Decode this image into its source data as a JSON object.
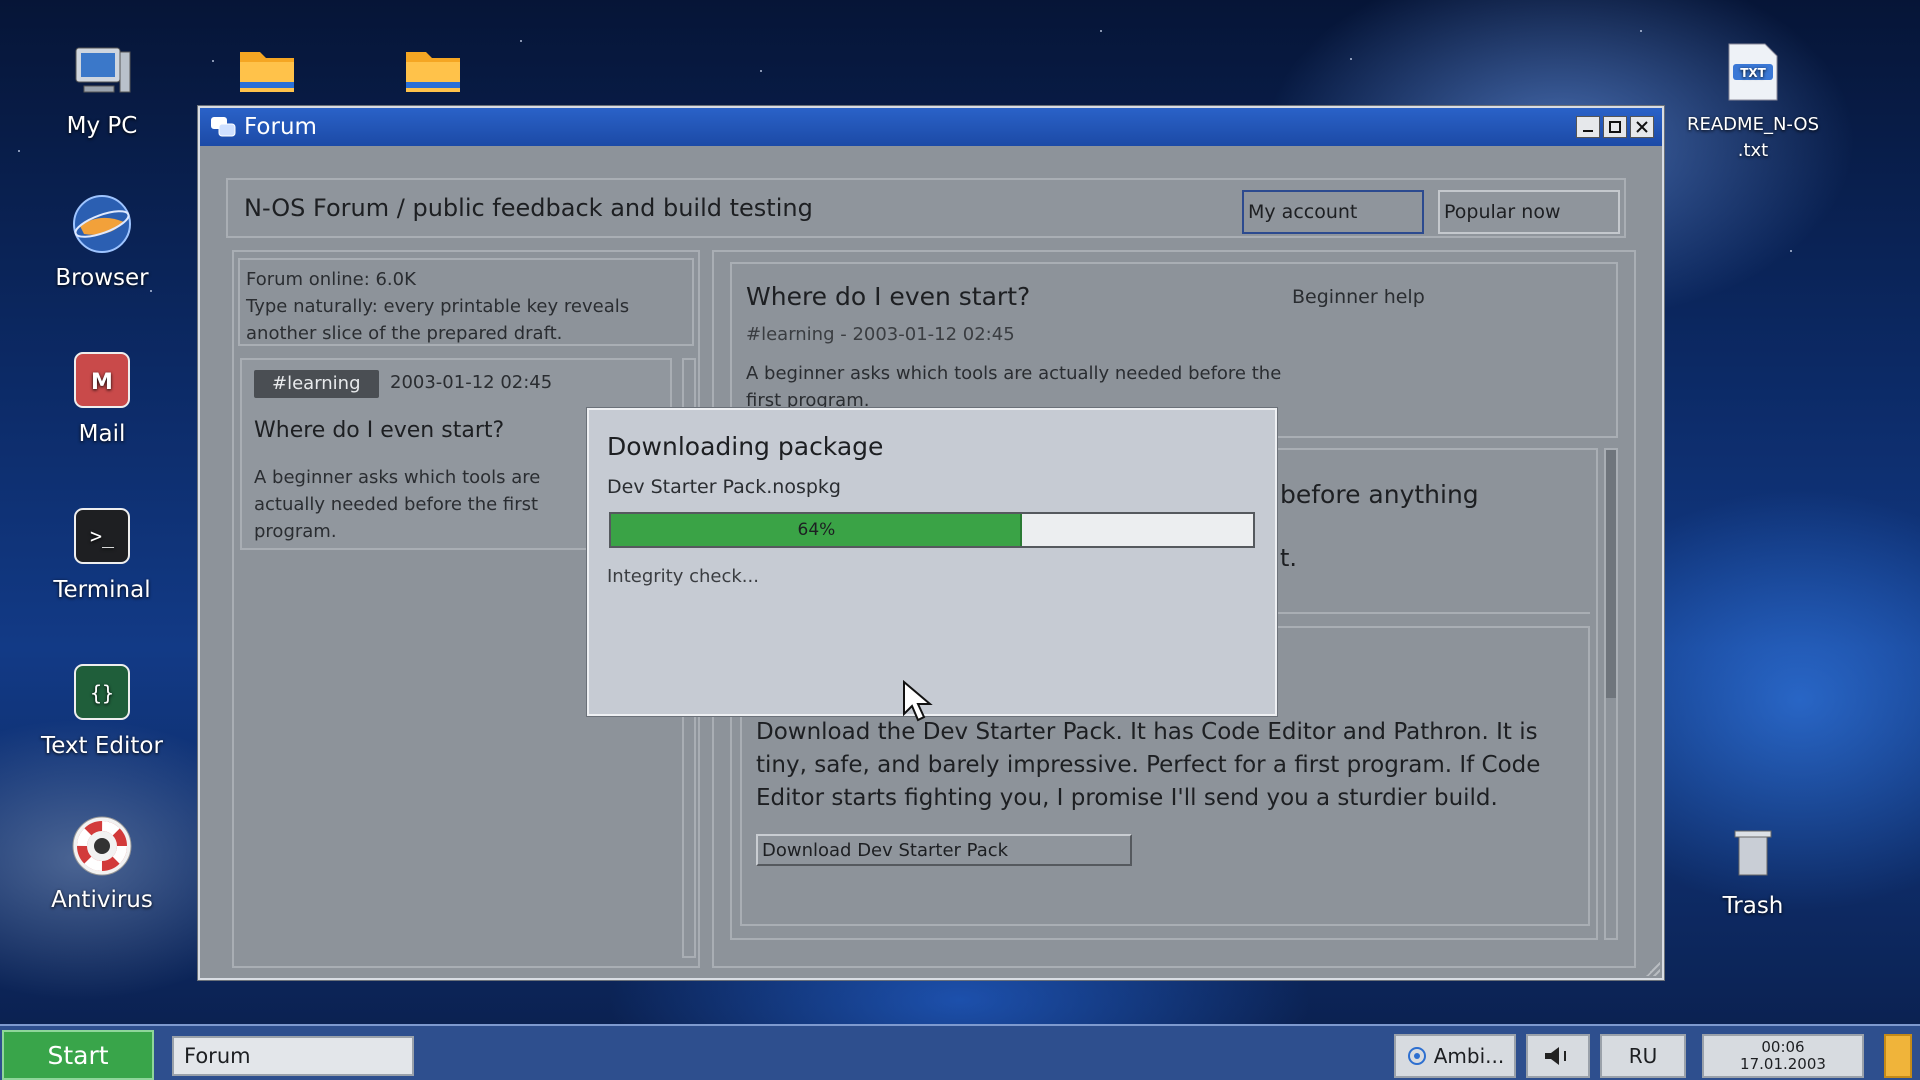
{
  "desktop": {
    "icons_left": [
      {
        "label": "My PC",
        "icon": "computer-icon"
      },
      {
        "label": "Browser",
        "icon": "globe-icon"
      },
      {
        "label": "Mail",
        "icon": "mail-icon"
      },
      {
        "label": "Terminal",
        "icon": "terminal-icon"
      },
      {
        "label": "Text Editor",
        "icon": "braces-icon"
      },
      {
        "label": "Antivirus",
        "icon": "lifebuoy-icon"
      }
    ],
    "folders": [
      "folder-icon",
      "folder-icon"
    ],
    "readme": {
      "line1": "README_N-OS",
      "line2": ".txt",
      "badge": "TXT"
    },
    "trash": {
      "label": "Trash"
    }
  },
  "window": {
    "title": "Forum",
    "buttons": [
      "minimize",
      "maximize",
      "close"
    ]
  },
  "forum": {
    "header_title": "N-OS Forum / public feedback and build testing",
    "my_account": "My account",
    "popular_now": "Popular now",
    "online": "Forum online: 6.0K",
    "hint": "Type naturally: every printable key reveals another slice of the prepared draft.",
    "left_card": {
      "tag": "#learning",
      "date": "2003-01-12 02:45",
      "title": "Where do I even start?",
      "text": "A beginner asks which tools are actually needed before the first program."
    },
    "post": {
      "title": "Where do I even start?",
      "category": "Beginner help",
      "meta": "#learning - 2003-01-12 02:45",
      "text": "A beginner asks which tools are actually needed before the first program."
    },
    "reply1": {
      "title_fragment": "before anything",
      "text_fragment": "t."
    },
    "reply2": {
      "text": "Download the Dev Starter Pack. It has Code Editor and Pathron. It is tiny, safe, and barely impressive. Perfect for a first program. If Code Editor starts fighting you, I promise I'll send you a sturdier build.",
      "button": "Download Dev Starter Pack"
    }
  },
  "download_dialog": {
    "title": "Downloading package",
    "file": "Dev Starter Pack.nospkg",
    "progress": 0.64,
    "progress_label": "64%",
    "status": "Integrity check..."
  },
  "taskbar": {
    "start": "Start",
    "task": "Forum",
    "ambient": "Ambi...",
    "volume_icon": "speaker-icon",
    "lang": "RU",
    "time": "00:06",
    "date": "17.01.2003"
  },
  "colors": {
    "titlebar": "#2a62c8",
    "progress_fill": "#3aa346",
    "start_button": "#39a54a",
    "taskbar": "#2e4f8e"
  }
}
